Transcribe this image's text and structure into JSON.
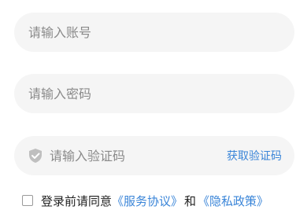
{
  "account": {
    "placeholder": "请输入账号",
    "value": ""
  },
  "password": {
    "placeholder": "请输入密码",
    "value": ""
  },
  "code": {
    "placeholder": "请输入验证码",
    "value": "",
    "icon": "shield-check-icon",
    "get_code_label": "获取验证码"
  },
  "agreement": {
    "checked": false,
    "prefix": "登录前请同意",
    "service_link": "《服务协议》",
    "conjunction": "和",
    "privacy_link": "《隐私政策》"
  },
  "colors": {
    "field_bg": "#f5f5f5",
    "link": "#3a85d8",
    "placeholder": "#8a8a8a",
    "text": "#222222"
  }
}
